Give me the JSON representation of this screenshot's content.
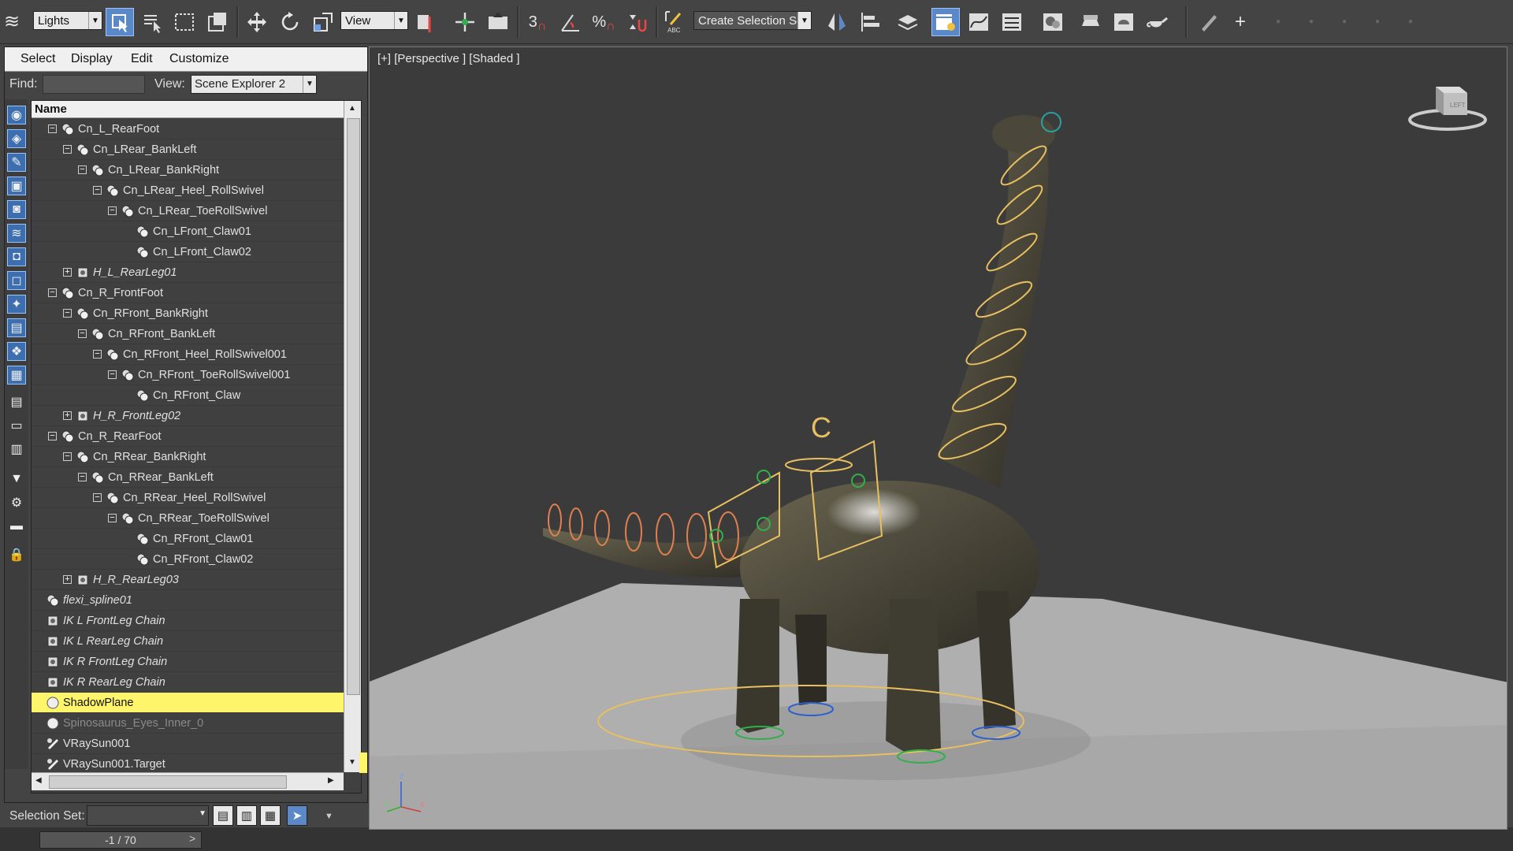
{
  "toolbar": {
    "selection_filter": "Lights",
    "reference_coord": "View",
    "named_selection_set": "Create Selection Se",
    "snap_toggle_label": "3",
    "percent_snap_label": "%"
  },
  "explorer": {
    "menu": [
      "Select",
      "Display",
      "Edit",
      "Customize"
    ],
    "find_label": "Find:",
    "find_value": "",
    "view_label": "View:",
    "view_value": "Scene Explorer 2",
    "column_header": "Name",
    "rows": [
      {
        "name": "Cn_L_RearFoot",
        "depth": 1,
        "expander": "minus",
        "icon": "group",
        "style": ""
      },
      {
        "name": "Cn_LRear_BankLeft",
        "depth": 2,
        "expander": "minus",
        "icon": "group",
        "style": ""
      },
      {
        "name": "Cn_LRear_BankRight",
        "depth": 3,
        "expander": "minus",
        "icon": "group",
        "style": ""
      },
      {
        "name": "Cn_LRear_Heel_RollSwivel",
        "depth": 4,
        "expander": "minus",
        "icon": "group",
        "style": ""
      },
      {
        "name": "Cn_LRear_ToeRollSwivel",
        "depth": 5,
        "expander": "minus",
        "icon": "group",
        "style": ""
      },
      {
        "name": "Cn_LFront_Claw01",
        "depth": 6,
        "expander": "",
        "icon": "group",
        "style": ""
      },
      {
        "name": "Cn_LFront_Claw02",
        "depth": 6,
        "expander": "",
        "icon": "group",
        "style": ""
      },
      {
        "name": "H_L_RearLeg01",
        "depth": 2,
        "expander": "plus",
        "icon": "helper",
        "style": "ital"
      },
      {
        "name": "Cn_R_FrontFoot",
        "depth": 1,
        "expander": "minus",
        "icon": "group",
        "style": ""
      },
      {
        "name": "Cn_RFront_BankRight",
        "depth": 2,
        "expander": "minus",
        "icon": "group",
        "style": ""
      },
      {
        "name": "Cn_RFront_BankLeft",
        "depth": 3,
        "expander": "minus",
        "icon": "group",
        "style": ""
      },
      {
        "name": "Cn_RFront_Heel_RollSwivel001",
        "depth": 4,
        "expander": "minus",
        "icon": "group",
        "style": ""
      },
      {
        "name": "Cn_RFront_ToeRollSwivel001",
        "depth": 5,
        "expander": "minus",
        "icon": "group",
        "style": ""
      },
      {
        "name": "Cn_RFront_Claw",
        "depth": 6,
        "expander": "",
        "icon": "group",
        "style": ""
      },
      {
        "name": "H_R_FrontLeg02",
        "depth": 2,
        "expander": "plus",
        "icon": "helper",
        "style": "ital"
      },
      {
        "name": "Cn_R_RearFoot",
        "depth": 1,
        "expander": "minus",
        "icon": "group",
        "style": ""
      },
      {
        "name": "Cn_RRear_BankRight",
        "depth": 2,
        "expander": "minus",
        "icon": "group",
        "style": ""
      },
      {
        "name": "Cn_RRear_BankLeft",
        "depth": 3,
        "expander": "minus",
        "icon": "group",
        "style": ""
      },
      {
        "name": "Cn_RRear_Heel_RollSwivel",
        "depth": 4,
        "expander": "minus",
        "icon": "group",
        "style": ""
      },
      {
        "name": "Cn_RRear_ToeRollSwivel",
        "depth": 5,
        "expander": "minus",
        "icon": "group",
        "style": ""
      },
      {
        "name": "Cn_RFront_Claw01",
        "depth": 6,
        "expander": "",
        "icon": "group",
        "style": ""
      },
      {
        "name": "Cn_RFront_Claw02",
        "depth": 6,
        "expander": "",
        "icon": "group",
        "style": ""
      },
      {
        "name": "H_R_RearLeg03",
        "depth": 2,
        "expander": "plus",
        "icon": "helper",
        "style": "ital"
      },
      {
        "name": "flexi_spline01",
        "depth": 0,
        "expander": "",
        "icon": "group",
        "style": "ital"
      },
      {
        "name": "IK L FrontLeg Chain",
        "depth": 0,
        "expander": "",
        "icon": "helper",
        "style": "ital"
      },
      {
        "name": "IK L RearLeg Chain",
        "depth": 0,
        "expander": "",
        "icon": "helper",
        "style": "ital"
      },
      {
        "name": "IK R FrontLeg Chain",
        "depth": 0,
        "expander": "",
        "icon": "helper",
        "style": "ital"
      },
      {
        "name": "IK R RearLeg Chain",
        "depth": 0,
        "expander": "",
        "icon": "helper",
        "style": "ital"
      },
      {
        "name": "ShadowPlane",
        "depth": 0,
        "expander": "",
        "icon": "sphere",
        "style": "sel"
      },
      {
        "name": "Spinosaurus_Eyes_Inner_0",
        "depth": 0,
        "expander": "",
        "icon": "sphere",
        "style": "dim"
      },
      {
        "name": "VRaySun001",
        "depth": 0,
        "expander": "",
        "icon": "light",
        "style": ""
      },
      {
        "name": "VRaySun001.Target",
        "depth": 0,
        "expander": "",
        "icon": "light",
        "style": ""
      }
    ],
    "selection_set_label": "Selection Set:",
    "selection_set_value": ""
  },
  "time_slider": {
    "label": "-1 / 70",
    "prev": "<",
    "next": ">"
  },
  "viewport": {
    "label": "[+] [Perspective ] [Shaded ]",
    "viewcube_face": "LEFT"
  },
  "colors": {
    "selected_row": "#fff56a",
    "active_button": "#5b88c7",
    "rig_orange": "#e8c060",
    "rig_green": "#2fb04a",
    "rig_blue": "#2a5fd0"
  }
}
